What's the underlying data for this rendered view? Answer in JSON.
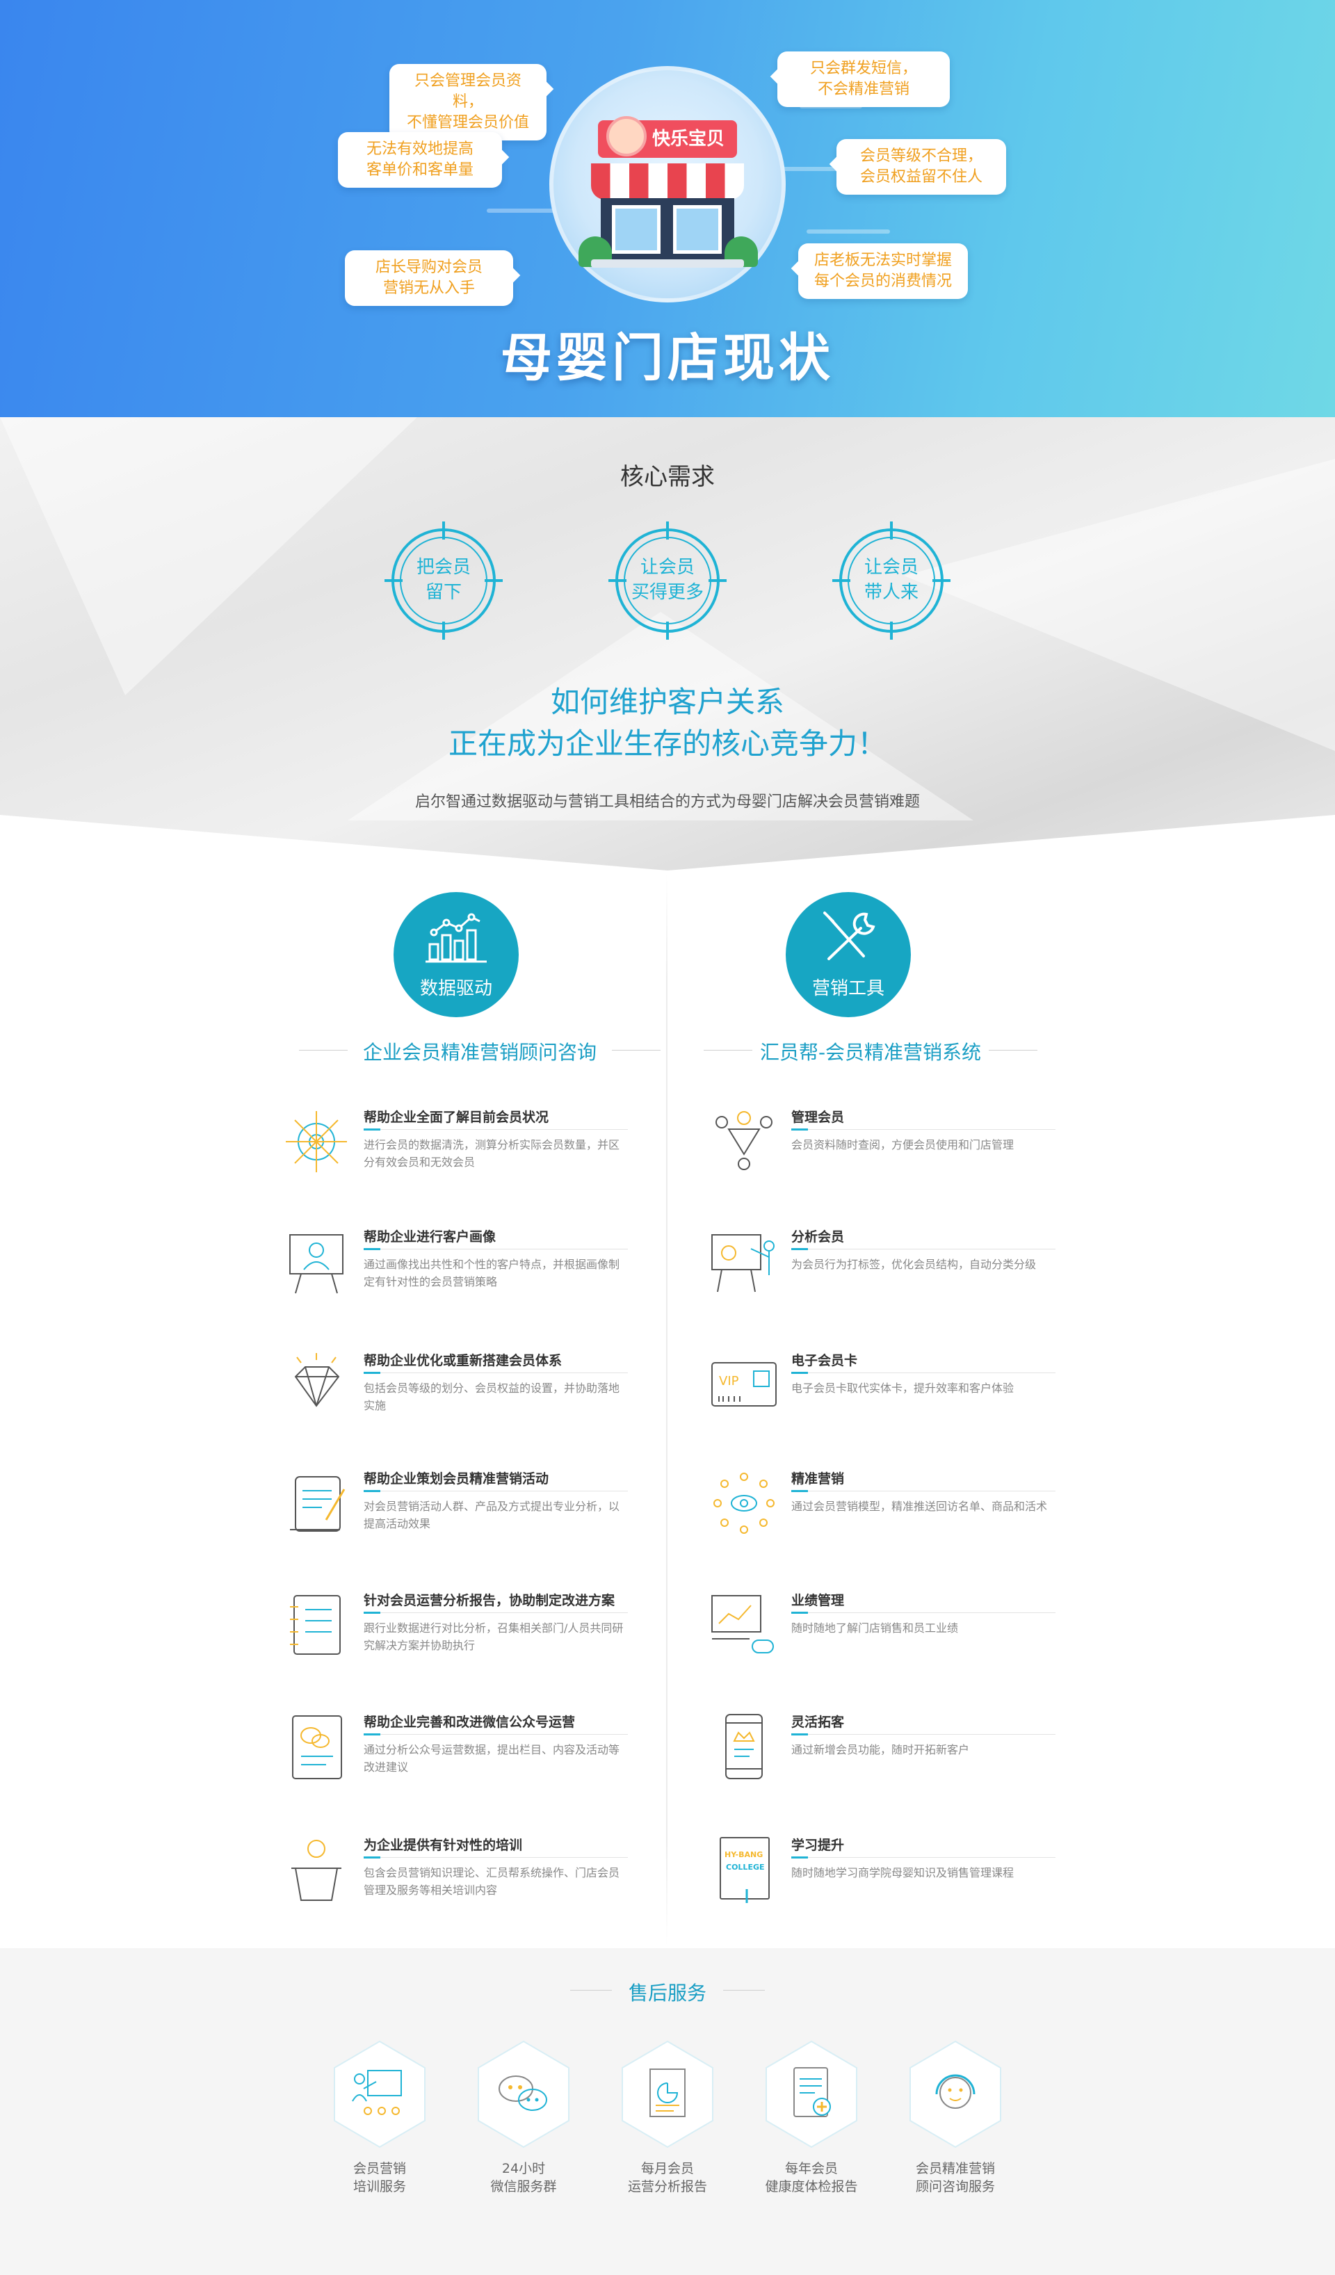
{
  "hero": {
    "title": "母婴门店现状",
    "shop_sign": "快乐宝贝",
    "bubbles": [
      "只会管理会员资料，\n不懂管理会员价值",
      "无法有效地提高\n客单价和客单量",
      "店长导购对会员\n营销无从入手",
      "只会群发短信，\n不会精准营销",
      "会员等级不合理，\n会员权益留不住人",
      "店老板无法实时掌握\n每个会员的消费情况"
    ]
  },
  "core": {
    "title": "核心需求",
    "targets": [
      "把会员\n留下",
      "让会员\n买得更多",
      "让会员\n带人来"
    ],
    "slogan_line1": "如何维护客户关系",
    "slogan_line2": "正在成为企业生存的核心竞争力！",
    "subtitle": "启尔智通过数据驱动与营销工具相结合的方式为母婴门店解决会员营销难题"
  },
  "left_col": {
    "badge": "数据驱动",
    "heading": "企业会员精准营销顾问咨询",
    "items": [
      {
        "title": "帮助企业全面了解目前会员状况",
        "desc": "进行会员的数据清洗，测算分析实际会员数量，并区分有效会员和无效会员"
      },
      {
        "title": "帮助企业进行客户画像",
        "desc": "通过画像找出共性和个性的客户特点，并根据画像制定有针对性的会员营销策略"
      },
      {
        "title": "帮助企业优化或重新搭建会员体系",
        "desc": "包括会员等级的划分、会员权益的设置，并协助落地实施"
      },
      {
        "title": "帮助企业策划会员精准营销活动",
        "desc": "对会员营销活动人群、产品及方式提出专业分析，以提高活动效果"
      },
      {
        "title": "针对会员运营分析报告，协助制定改进方案",
        "desc": "跟行业数据进行对比分析，召集相关部门/人员共同研究解决方案并协助执行"
      },
      {
        "title": "帮助企业完善和改进微信公众号运营",
        "desc": "通过分析公众号运营数据，提出栏目、内容及活动等改进建议"
      },
      {
        "title": "为企业提供有针对性的培训",
        "desc": "包含会员营销知识理论、汇员帮系统操作、门店会员管理及服务等相关培训内容"
      }
    ]
  },
  "right_col": {
    "badge": "营销工具",
    "heading": "汇员帮-会员精准营销系统",
    "items": [
      {
        "title": "管理会员",
        "desc": "会员资料随时查阅，方便会员使用和门店管理"
      },
      {
        "title": "分析会员",
        "desc": "为会员行为打标签，优化会员结构，自动分类分级"
      },
      {
        "title": "电子会员卡",
        "desc": "电子会员卡取代实体卡，提升效率和客户体验"
      },
      {
        "title": "精准营销",
        "desc": "通过会员营销模型，精准推送回访名单、商品和活术"
      },
      {
        "title": "业绩管理",
        "desc": "随时随地了解门店销售和员工业绩"
      },
      {
        "title": "灵活拓客",
        "desc": "通过新增会员功能，随时开拓新客户"
      },
      {
        "title": "学习提升",
        "desc": "随时随地学习商学院母婴知识及销售管理课程"
      }
    ],
    "vip_text": "VIP",
    "book_text_1": "HY-BANG",
    "book_text_2": "COLLEGE"
  },
  "after_sales": {
    "title": "售后服务",
    "items": [
      {
        "label": "会员营销\n培训服务",
        "icon": "training-icon"
      },
      {
        "label": "24小时\n微信服务群",
        "icon": "wechat-icon"
      },
      {
        "label": "每月会员\n运营分析报告",
        "icon": "report-icon"
      },
      {
        "label": "每年会员\n健康度体检报告",
        "icon": "health-check-icon"
      },
      {
        "label": "会员精准营销\n顾问咨询服务",
        "icon": "consultant-icon"
      }
    ]
  },
  "colors": {
    "accent": "#1fb3d5",
    "teal": "#17a6c3",
    "bubble_text": "#f0a020",
    "hero_start": "#3a86ee",
    "hero_end": "#6fd8e6"
  }
}
